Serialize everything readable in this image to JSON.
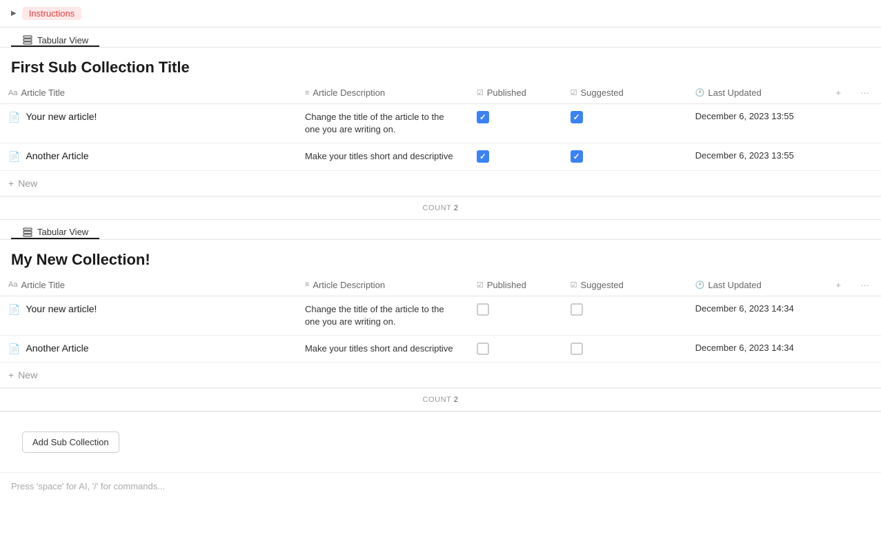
{
  "instructions": {
    "arrow": "▶",
    "label": "Instructions"
  },
  "sections": [
    {
      "id": "section-1",
      "tab_label": "Tabular View",
      "title": "First Sub Collection Title",
      "columns": {
        "article_title": "Article Title",
        "article_description": "Article Description",
        "published": "Published",
        "suggested": "Suggested",
        "last_updated": "Last Updated"
      },
      "rows": [
        {
          "title": "Your new article!",
          "description": "Change the title of the article to the one you are writing on.",
          "published": true,
          "suggested": true,
          "last_updated": "December 6, 2023 13:55"
        },
        {
          "title": "Another Article",
          "description": "Make your titles short and descriptive",
          "published": true,
          "suggested": true,
          "last_updated": "December 6, 2023 13:55"
        }
      ],
      "new_label": "New",
      "count_label": "COUNT",
      "count": "2"
    },
    {
      "id": "section-2",
      "tab_label": "Tabular View",
      "title": "My New Collection!",
      "columns": {
        "article_title": "Article Title",
        "article_description": "Article Description",
        "published": "Published",
        "suggested": "Suggested",
        "last_updated": "Last Updated"
      },
      "rows": [
        {
          "title": "Your new article!",
          "description": "Change the title of the article to the one you are writing on.",
          "published": false,
          "suggested": false,
          "last_updated": "December 6, 2023 14:34"
        },
        {
          "title": "Another Article",
          "description": "Make your titles short and descriptive",
          "published": false,
          "suggested": false,
          "last_updated": "December 6, 2023 14:34"
        }
      ],
      "new_label": "New",
      "count_label": "COUNT",
      "count": "2"
    }
  ],
  "add_collection_btn": "Add Sub Collection",
  "footer_hint": "Press 'space' for AI, '/' for commands..."
}
